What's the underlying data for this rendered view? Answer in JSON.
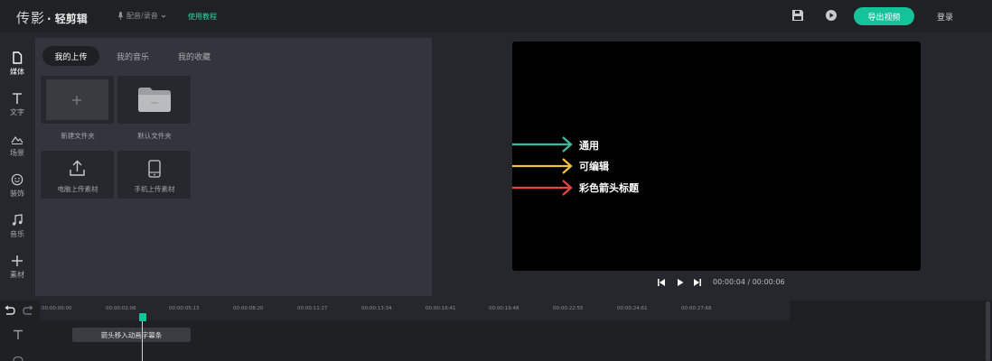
{
  "app": {
    "logo_light": "传影",
    "logo_bold": "· 轻剪辑",
    "dub_label": "配音/录音",
    "tutorial_label": "使用教程",
    "export_label": "导出视频",
    "login_label": "登录",
    "accent_color": "#15c39a"
  },
  "sidebar": {
    "items": [
      {
        "label": "媒体",
        "icon": "file-icon"
      },
      {
        "label": "文字",
        "icon": "text-icon"
      },
      {
        "label": "场景",
        "icon": "mountain-icon"
      },
      {
        "label": "装饰",
        "icon": "smile-icon"
      },
      {
        "label": "音乐",
        "icon": "music-note-icon"
      },
      {
        "label": "素材",
        "icon": "plus-icon"
      }
    ],
    "active": "媒体"
  },
  "library": {
    "tabs": [
      "我的上传",
      "我的音乐",
      "我的收藏"
    ],
    "active_tab": "我的上传",
    "tiles": [
      {
        "label": "新建文件夹",
        "icon": "plus-icon"
      },
      {
        "label": "默认文件夹",
        "icon": "folder-icon"
      },
      {
        "label": "电脑上传素材",
        "icon": "upload-icon"
      },
      {
        "label": "手机上传素材",
        "icon": "phone-icon"
      }
    ]
  },
  "preview": {
    "arrows": [
      {
        "label": "通用",
        "color": "#3dbba5"
      },
      {
        "label": "可编辑",
        "color": "#f2c037"
      },
      {
        "label": "彩色箭头标题",
        "color": "#e8453c"
      }
    ],
    "timecode": "00:00:04 / 00:00:06"
  },
  "timeline": {
    "ticks": [
      "00:00:00:00",
      "00:00:02:06",
      "00:00:05:13",
      "00:00:08:20",
      "00:00:11:27",
      "00:00:13:34",
      "00:00:16:41",
      "00:00:19:48",
      "00:00:22:55",
      "00:00:24:61",
      "00:00:27:68"
    ],
    "clip_label": "箭头移入动画字幕条"
  }
}
